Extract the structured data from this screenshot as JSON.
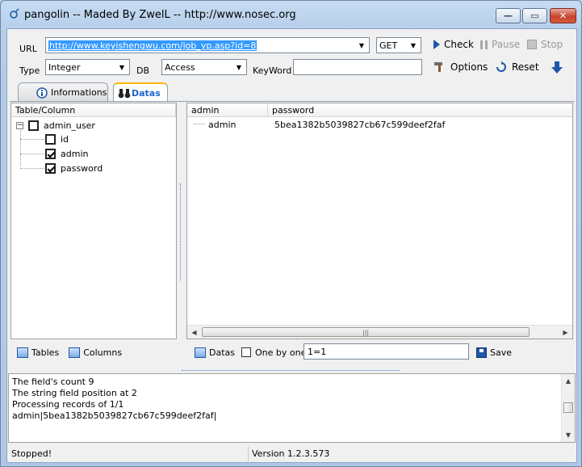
{
  "window": {
    "title": "pangolin -- Maded By ZwelL -- http://www.nosec.org"
  },
  "toolbar": {
    "url_label": "URL",
    "url_value": "http://www.keyishengwu.com/job_yp.asp?id=8",
    "method_value": "GET",
    "check_label": "Check",
    "pause_label": "Pause",
    "stop_label": "Stop",
    "type_label": "Type",
    "type_value": "Integer",
    "db_label": "DB",
    "db_value": "Access",
    "keyword_label": "KeyWord",
    "keyword_value": "",
    "options_label": "Options",
    "reset_label": "Reset"
  },
  "tabs": [
    {
      "label": "Informations",
      "active": false
    },
    {
      "label": "Datas",
      "active": true
    }
  ],
  "tree": {
    "header": "Table/Column",
    "table": {
      "name": "admin_user",
      "checked": false,
      "expander": "−"
    },
    "columns": [
      {
        "name": "id",
        "checked": false
      },
      {
        "name": "admin",
        "checked": true
      },
      {
        "name": "password",
        "checked": true
      }
    ]
  },
  "grid": {
    "columns": [
      "admin",
      "password"
    ],
    "rows": [
      {
        "admin": "admin",
        "password": "5bea1382b5039827cb67c599deef2faf"
      }
    ]
  },
  "left_bottom": {
    "tables_label": "Tables",
    "columns_label": "Columns"
  },
  "right_bottom": {
    "datas_label": "Datas",
    "one_by_one_label": "One by one",
    "one_by_one_checked": false,
    "condition_value": "1=1",
    "save_label": "Save"
  },
  "log": {
    "lines": [
      "The field's count 9",
      "The string field position at 2",
      "Processing records of 1/1",
      "admin|5bea1382b5039827cb67c599deef2faf|"
    ]
  },
  "status": {
    "state": "Stopped!",
    "version": "Version  1.2.3.573"
  },
  "colors": {
    "accent": "#1b66c9",
    "selection": "#3399ff",
    "tab_highlight": "#ffb400"
  }
}
